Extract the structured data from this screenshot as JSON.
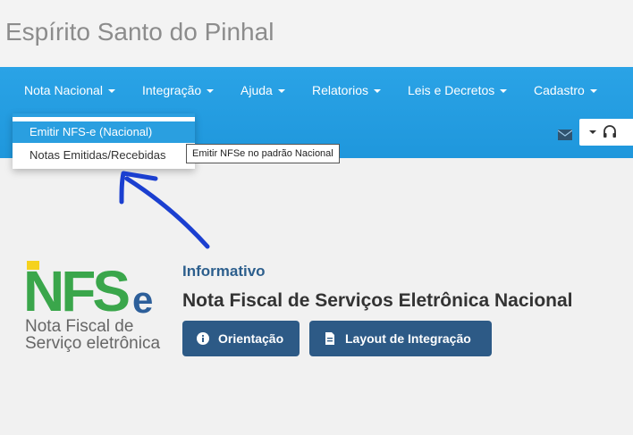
{
  "header": {
    "city": "Espírito Santo do Pinhal"
  },
  "nav": {
    "items": [
      {
        "label": "Nota Nacional"
      },
      {
        "label": "Integração"
      },
      {
        "label": "Ajuda"
      },
      {
        "label": "Relatorios"
      },
      {
        "label": "Leis e Decretos"
      },
      {
        "label": "Cadastro"
      }
    ]
  },
  "dropdown": {
    "items": [
      {
        "label": "Emitir NFS-e (Nacional)",
        "active": true
      },
      {
        "label": "Notas Emitidas/Recebidas",
        "active": false
      }
    ],
    "tooltip": "Emitir NFSe no padrão Nacional"
  },
  "logo": {
    "text": "NFSe",
    "caption1": "Nota Fiscal de",
    "caption2": "Serviço eletrônica"
  },
  "main": {
    "label": "Informativo",
    "title": "Nota Fiscal de Serviços Eletrônica Nacional",
    "buttons": {
      "orientacao": "Orientação",
      "layout": "Layout de Integração"
    }
  },
  "colors": {
    "navbar": "#2aa3e6",
    "dropdown_active": "#2a9fe0",
    "button": "#2d5a86",
    "label": "#2d5f8d",
    "arrow": "#1b3fd0",
    "logo_green": "#3aa64b",
    "logo_blue": "#2d5f9a",
    "logo_yellow": "#f5d21f"
  },
  "icons": {
    "mail": "envelope-icon",
    "support": "headset-icon",
    "info": "info-icon",
    "document": "document-icon",
    "annotation": "hand-drawn-arrow"
  }
}
